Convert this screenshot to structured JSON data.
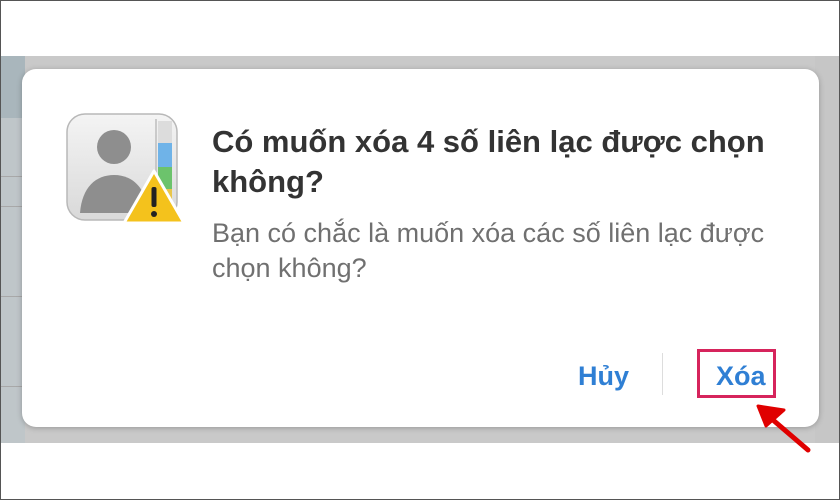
{
  "dialog": {
    "title": "Có muốn xóa 4 số liên lạc được chọn không?",
    "message": "Bạn có chắc là muốn xóa các số liên lạc được chọn không?",
    "cancel_label": "Hủy",
    "delete_label": "Xóa",
    "icon": "contacts-app-icon-with-warning"
  },
  "annotation": {
    "highlight_target": "delete-button",
    "highlight_color": "#d6245c",
    "arrow_color": "#e00000"
  },
  "colors": {
    "button_text": "#2f7fd4",
    "title_text": "#333333",
    "message_text": "#707070",
    "backdrop": "#c9c9c9"
  }
}
